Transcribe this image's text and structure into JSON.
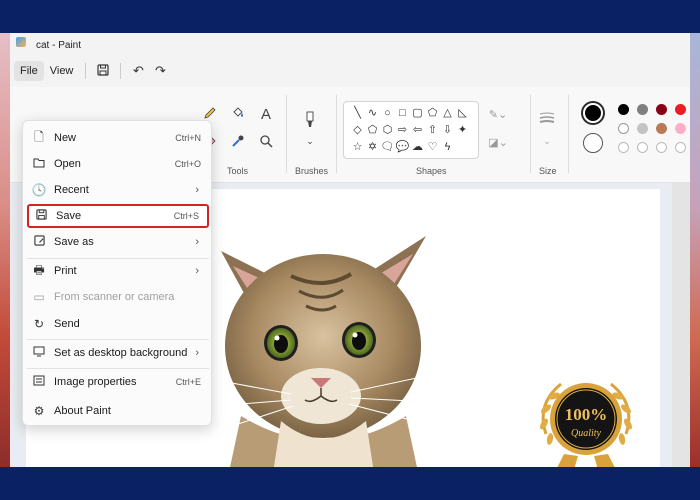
{
  "window": {
    "title": "cat - Paint"
  },
  "menubar": {
    "file": "File",
    "view": "View"
  },
  "ribbon": {
    "tools_label": "Tools",
    "brushes_label": "Brushes",
    "shapes_label": "Shapes",
    "size_label": "Size",
    "text_tool": "A"
  },
  "filemenu": {
    "items": [
      {
        "label": "New",
        "shortcut": "Ctrl+N",
        "icon": "new-file-icon"
      },
      {
        "label": "Open",
        "shortcut": "Ctrl+O",
        "icon": "folder-icon"
      },
      {
        "label": "Recent",
        "icon": "clock-icon",
        "submenu": true
      },
      {
        "label": "Save",
        "shortcut": "Ctrl+S",
        "icon": "save-icon",
        "highlighted": true
      },
      {
        "label": "Save as",
        "icon": "save-as-icon",
        "submenu": true
      },
      {
        "label": "Print",
        "icon": "printer-icon",
        "submenu": true
      },
      {
        "label": "From scanner or camera",
        "icon": "scanner-icon",
        "disabled": true
      },
      {
        "label": "Send",
        "icon": "send-icon"
      },
      {
        "label": "Set as desktop background",
        "icon": "desktop-icon",
        "submenu": true
      },
      {
        "label": "Image properties",
        "shortcut": "Ctrl+E",
        "icon": "image-properties-icon"
      },
      {
        "label": "About Paint",
        "icon": "gear-icon"
      }
    ],
    "chevron": "›"
  },
  "badge": {
    "percent": "100%",
    "text": "Quality"
  },
  "colors": {
    "highlight_border": "#d42424",
    "primary": "#000000",
    "palette_row1": [
      "#000000",
      "#7f7f7f",
      "#880015",
      "#ed1c24",
      "#ff7f27"
    ],
    "palette_row2": [
      "#ffffff",
      "#c3c3c3",
      "#b97a57",
      "#ffaec9",
      "#ffc90e"
    ]
  }
}
